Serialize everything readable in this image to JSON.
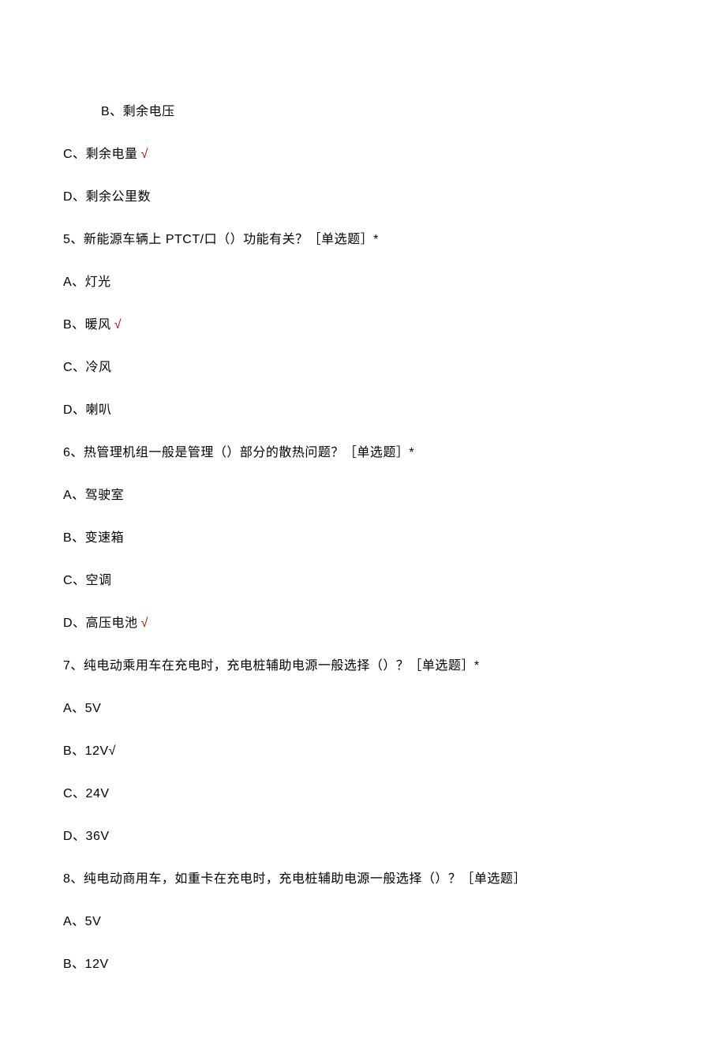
{
  "lines": [
    {
      "text": "B、剩余电压",
      "indent": true,
      "check": false
    },
    {
      "text": "C、剩余电量",
      "indent": false,
      "check": true
    },
    {
      "text": "D、剩余公里数",
      "indent": false,
      "check": false
    },
    {
      "text": "5、新能源车辆上 PTCT/口（）功能有关？［单选题］*",
      "indent": false,
      "check": false
    },
    {
      "text": "A、灯光",
      "indent": false,
      "check": false
    },
    {
      "text": "B、暖风",
      "indent": false,
      "check": true
    },
    {
      "text": "C、冷风",
      "indent": false,
      "check": false
    },
    {
      "text": "D、喇叭",
      "indent": false,
      "check": false
    },
    {
      "text": "6、热管理机组一般是管理（）部分的散热问题？［单选题］*",
      "indent": false,
      "check": false
    },
    {
      "text": "A、驾驶室",
      "indent": false,
      "check": false
    },
    {
      "text": "B、变速箱",
      "indent": false,
      "check": false
    },
    {
      "text": "C、空调",
      "indent": false,
      "check": false
    },
    {
      "text": "D、高压电池",
      "indent": false,
      "check": true
    },
    {
      "text": "7、纯电动乘用车在充电时，充电桩辅助电源一般选择（）？［单选题］*",
      "indent": false,
      "check": false
    },
    {
      "text": "A、5V",
      "indent": false,
      "check": false
    },
    {
      "text": "B、12V√",
      "indent": false,
      "check": false
    },
    {
      "text": "C、24V",
      "indent": false,
      "check": false
    },
    {
      "text": "D、36V",
      "indent": false,
      "check": false
    },
    {
      "text": "8、纯电动商用车，如重卡在充电时，充电桩辅助电源一般选择（）？［单选题］",
      "indent": false,
      "check": false
    },
    {
      "text": "A、5V",
      "indent": false,
      "check": false
    },
    {
      "text": "B、12V",
      "indent": false,
      "check": false
    }
  ],
  "check_symbol": "√"
}
